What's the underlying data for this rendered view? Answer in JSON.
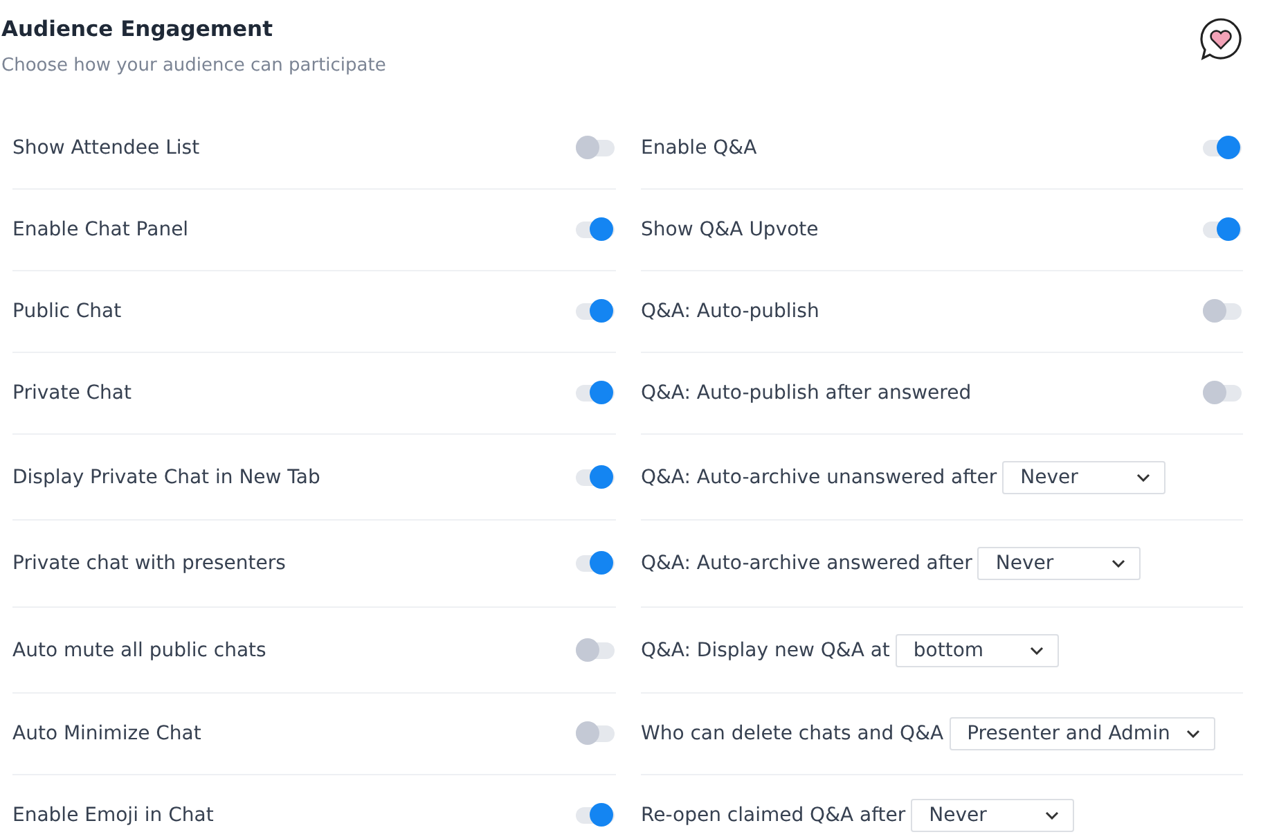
{
  "header": {
    "title": "Audience Engagement",
    "subtitle": "Choose how your audience can participate"
  },
  "left_settings": [
    {
      "label": "Show Attendee List",
      "on": false
    },
    {
      "label": "Enable Chat Panel",
      "on": true
    },
    {
      "label": "Public Chat",
      "on": true
    },
    {
      "label": "Private Chat",
      "on": true
    },
    {
      "label": "Display Private Chat in New Tab",
      "on": true
    },
    {
      "label": "Private chat with presenters",
      "on": true
    },
    {
      "label": "Auto mute all public chats",
      "on": false
    },
    {
      "label": "Auto Minimize Chat",
      "on": false
    },
    {
      "label": "Enable Emoji in Chat",
      "on": true
    }
  ],
  "right_settings": [
    {
      "kind": "toggle",
      "label": "Enable Q&A",
      "on": true
    },
    {
      "kind": "toggle",
      "label": "Show Q&A Upvote",
      "on": true
    },
    {
      "kind": "toggle",
      "label": "Q&A: Auto-publish",
      "on": false
    },
    {
      "kind": "toggle",
      "label": "Q&A: Auto-publish after answered",
      "on": false
    },
    {
      "kind": "select",
      "label": "Q&A: Auto-archive unanswered after",
      "value": "Never"
    },
    {
      "kind": "select",
      "label": "Q&A: Auto-archive answered after",
      "value": "Never"
    },
    {
      "kind": "select",
      "label": "Q&A: Display new Q&A at",
      "value": "bottom"
    },
    {
      "kind": "select",
      "label": "Who can delete chats and Q&A",
      "value": "Presenter and Admin"
    },
    {
      "kind": "select",
      "label": "Re-open claimed Q&A after",
      "value": "Never"
    }
  ]
}
